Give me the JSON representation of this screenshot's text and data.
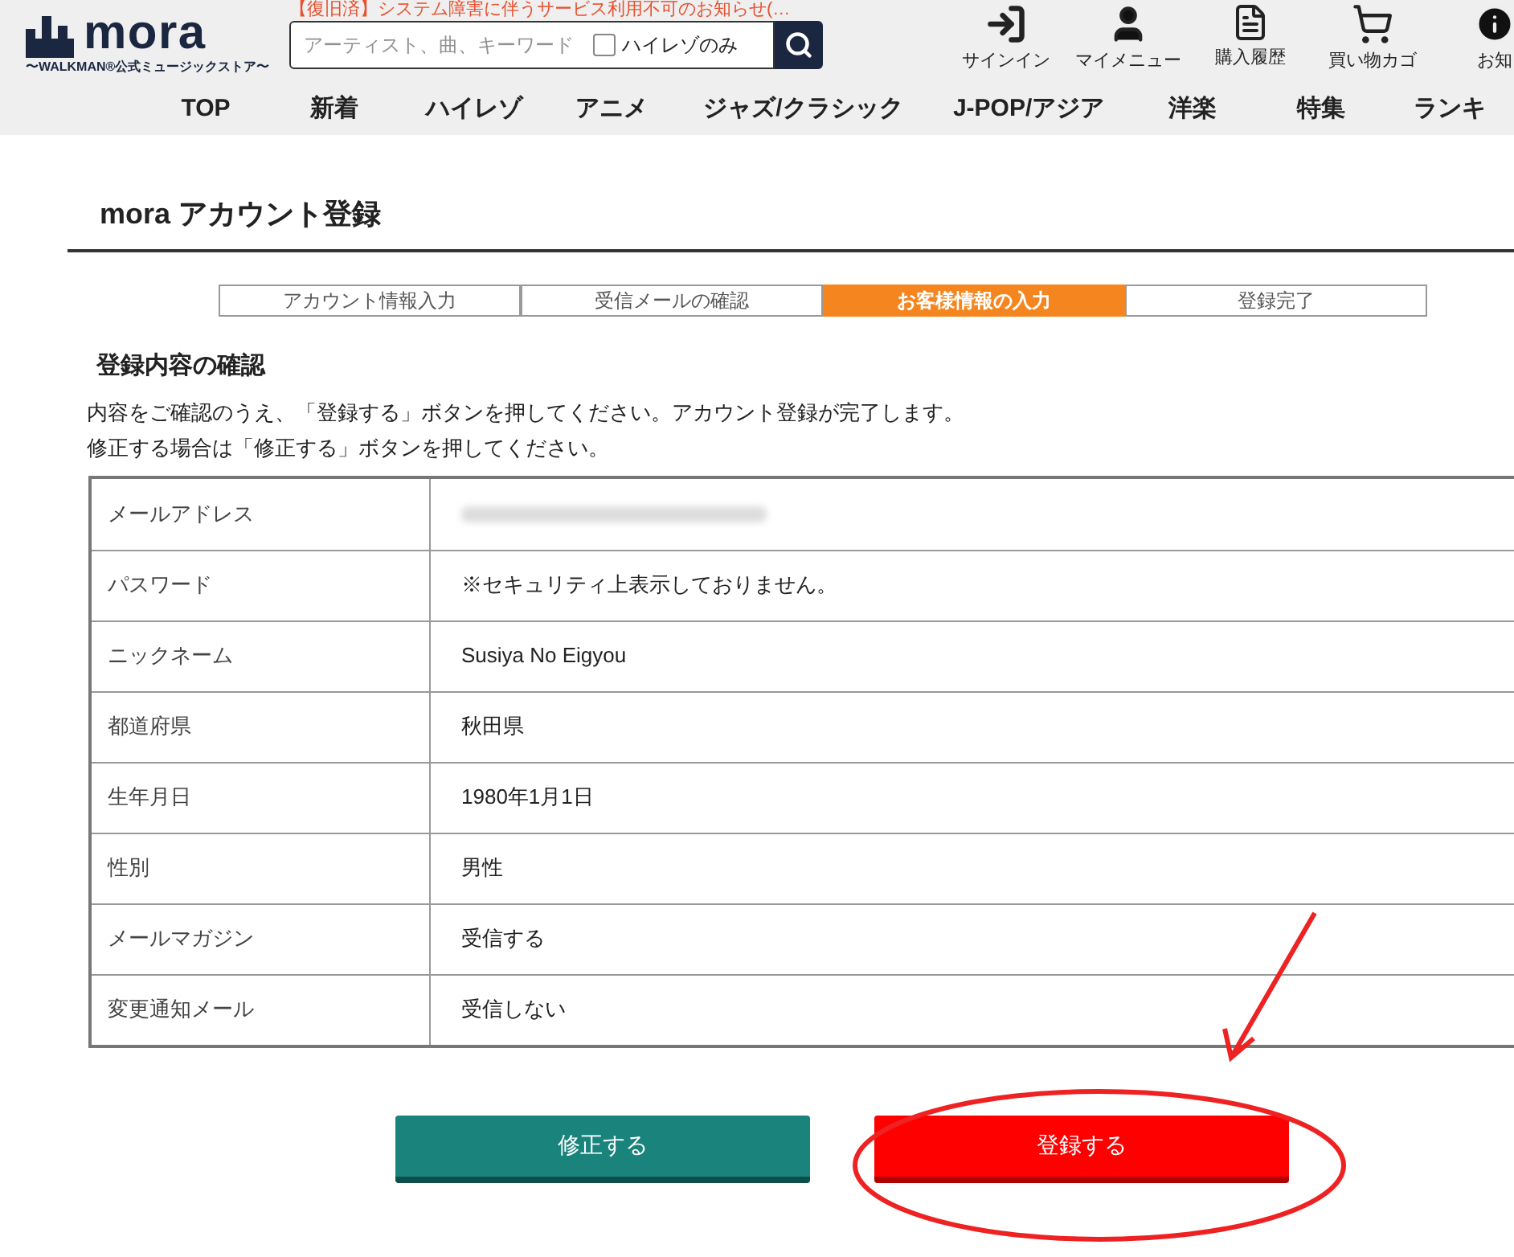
{
  "header": {
    "notice": "【復旧済】システム障害に伴うサービス利用不可のお知らせ(…",
    "logo": {
      "name": "mora",
      "tagline": "〜WALKMAN®公式ミュージックストア〜"
    },
    "search": {
      "placeholder": "アーティスト、曲、キーワード",
      "hires_only": {
        "label": "ハイレゾのみ",
        "checked": false
      }
    },
    "icons": [
      {
        "kind": "signin",
        "label": "サインイン"
      },
      {
        "kind": "user",
        "label": "マイメニュー"
      },
      {
        "kind": "history",
        "label": "購入履歴"
      },
      {
        "kind": "cart",
        "label": "買い物カゴ"
      },
      {
        "kind": "info",
        "label": "お知"
      }
    ]
  },
  "nav": [
    "TOP",
    "新着",
    "ハイレゾ",
    "アニメ",
    "ジャズ/クラシック",
    "J-POP/アジア",
    "洋楽",
    "特集",
    "ランキ"
  ],
  "page_title": "mora アカウント登録",
  "steps": [
    {
      "label": "アカウント情報入力",
      "selected": false
    },
    {
      "label": "受信メールの確認",
      "selected": false
    },
    {
      "label": "お客様情報の入力",
      "selected": true
    },
    {
      "label": "登録完了",
      "selected": false
    }
  ],
  "section_title": "登録内容の確認",
  "instructions": [
    "内容をご確認のうえ、「登録する」ボタンを押してください。アカウント登録が完了します。",
    "修正する場合は「修正する」ボタンを押してください。"
  ],
  "rows": [
    {
      "label": "メールアドレス",
      "kind": "blurred"
    },
    {
      "label": "パスワード",
      "kind": "text",
      "value": "※セキュリティ上表示しておりません。"
    },
    {
      "label": "ニックネーム",
      "kind": "text",
      "value": "Susiya No Eigyou"
    },
    {
      "label": "都道府県",
      "kind": "text",
      "value": "秋田県"
    },
    {
      "label": "生年月日",
      "kind": "text",
      "value": "1980年1月1日"
    },
    {
      "label": "性別",
      "kind": "text",
      "value": "男性"
    },
    {
      "label": "メールマガジン",
      "kind": "text",
      "value": "受信する"
    },
    {
      "label": "変更通知メール",
      "kind": "text",
      "value": "受信しない"
    }
  ],
  "buttons": [
    {
      "kind": "edit",
      "label": "修正する"
    },
    {
      "kind": "register",
      "label": "登録する"
    }
  ]
}
